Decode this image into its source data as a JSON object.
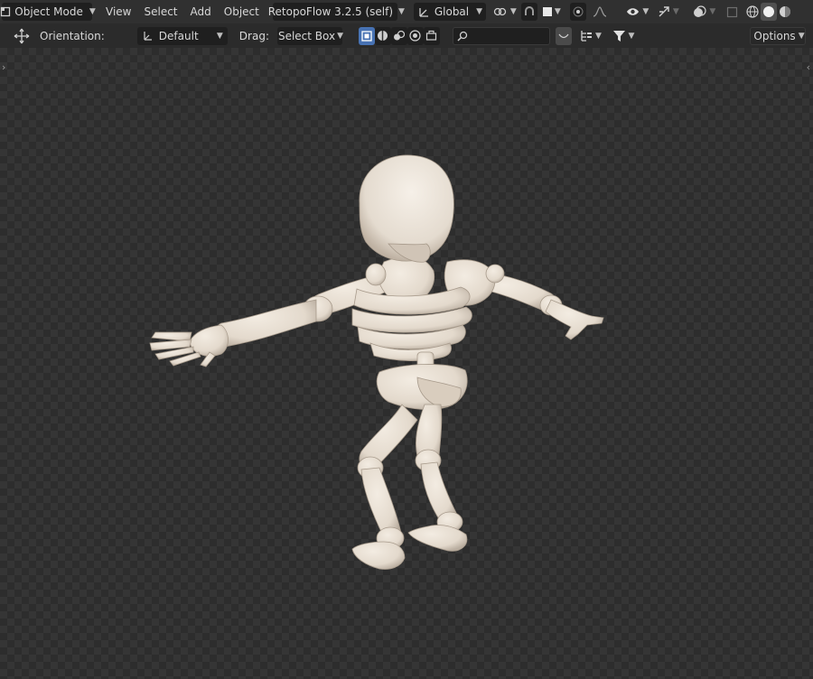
{
  "header": {
    "mode_label": "Object Mode",
    "menu": [
      "View",
      "Select",
      "Add",
      "Object"
    ],
    "addon_label": "RetopoFlow 3.2.5 (self)",
    "transform_orientation": "Global"
  },
  "tool_header": {
    "orientation_label": "Orientation:",
    "orientation_value": "Default",
    "drag_label": "Drag:",
    "drag_value": "Select Box",
    "search_value": "",
    "options_label": "Options"
  },
  "colors": {
    "header_bg": "#303030",
    "accent_blue": "#4772b3",
    "checker_light": "#353535",
    "checker_dark": "#2d2d2d",
    "bone": "#e8e0d4"
  },
  "icons": {
    "mode": "object-mode-icon",
    "transform_pivot": "pivot-icon",
    "snap": "magnet-icon",
    "proportional": "proportional-edit-icon",
    "visibility": "eye-icon",
    "gizmo": "gizmo-icon",
    "overlay": "overlay-icon",
    "xray": "xray-icon",
    "shading": [
      "wireframe-icon",
      "solid-icon",
      "material-icon",
      "rendered-icon"
    ],
    "move": "move-icon",
    "filter": "filter-icon"
  }
}
